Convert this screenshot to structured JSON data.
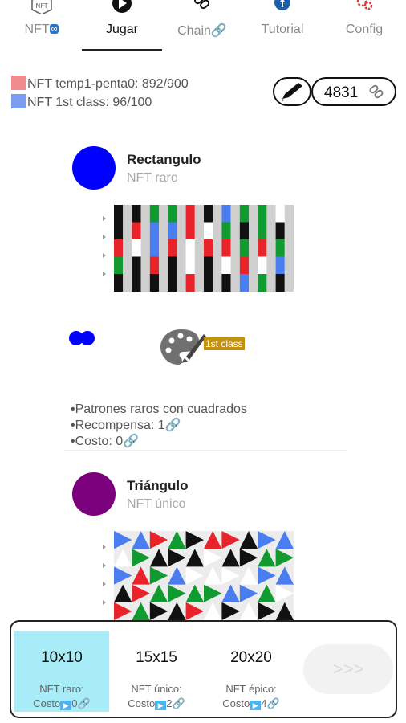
{
  "tabs": [
    {
      "label": "NFT",
      "icon": "nft-icon",
      "badge": "∞"
    },
    {
      "label": "Jugar",
      "icon": "play-icon"
    },
    {
      "label": "Chain🔗",
      "icon": "chain-icon"
    },
    {
      "label": "Tutorial",
      "icon": "tutorial-icon"
    },
    {
      "label": "Config",
      "icon": "gear-icon"
    }
  ],
  "counters": {
    "temp": "NFT temp1-penta0: 892/900",
    "first_class": "NFT 1st class: 96/100",
    "coins": "4831",
    "colors": {
      "temp": "#f08c8c",
      "first_class": "#7b9cf0"
    }
  },
  "cards": [
    {
      "title": "Rectangulo",
      "subtitle": "NFT raro",
      "avatar_color": "#0000ff",
      "badge": "1st class",
      "bullets": [
        "•Patrones raros con cuadrados",
        "•Recompensa: 1🔗",
        "•Costo: 0🔗"
      ]
    },
    {
      "title": "Triángulo",
      "subtitle": "NFT único",
      "avatar_color": "#7b007b"
    }
  ],
  "options": [
    {
      "size": "10x10",
      "rarity": "NFT raro:",
      "cost_prefix": "Costo",
      "cost": "0🔗"
    },
    {
      "size": "15x15",
      "rarity": "NFT único:",
      "cost_prefix": "Costo",
      "cost": "2🔗"
    },
    {
      "size": "20x20",
      "rarity": "NFT épico:",
      "cost_prefix": "Costo",
      "cost": "4🔗"
    }
  ],
  "next_label": ">>>"
}
